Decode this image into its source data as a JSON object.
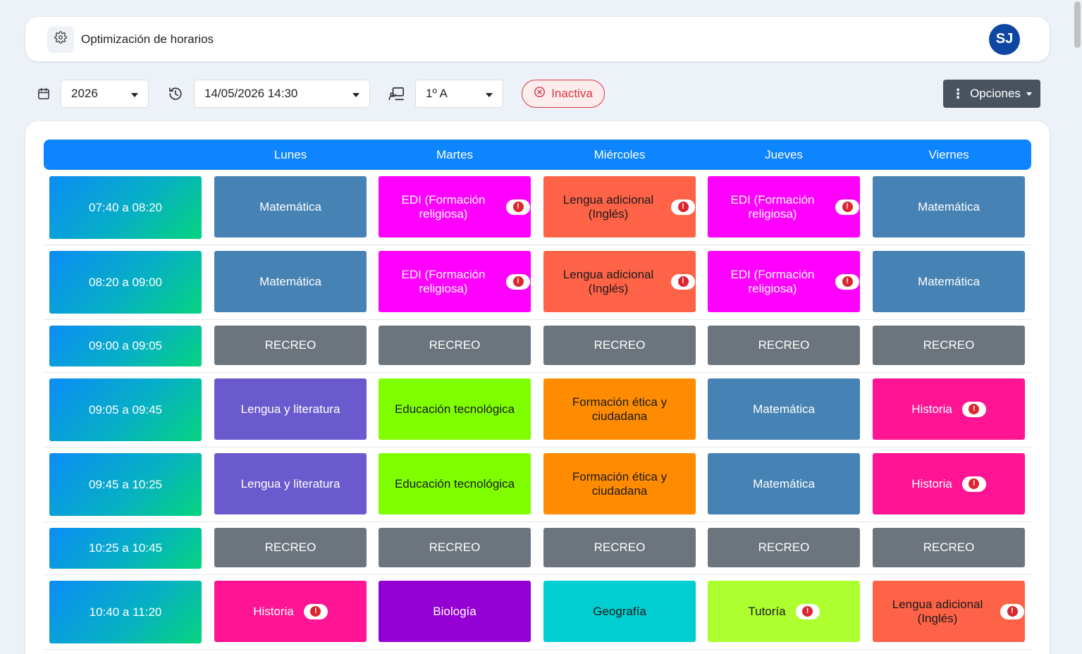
{
  "header": {
    "title": "Optimización de horarios",
    "avatar_initials": "SJ"
  },
  "toolbar": {
    "year_value": "2026",
    "datetime_value": "14/05/2026 14:30",
    "course_value": "1º A",
    "status_label": "Inactiva",
    "options_label": "Opciones"
  },
  "schedule": {
    "days": [
      "Lunes",
      "Martes",
      "Miércoles",
      "Jueves",
      "Viernes"
    ],
    "rows": [
      {
        "time": "07:40 a 08:20",
        "cells": [
          {
            "subject": "Matemática",
            "color": "#4682b4",
            "fg": "#ffffff",
            "alert": false
          },
          {
            "subject": "EDI (Formación religiosa)",
            "color": "#ff00ff",
            "fg": "#ffffff",
            "alert": true
          },
          {
            "subject": "Lengua adicional (Inglés)",
            "color": "#ff6347",
            "fg": "#1a1a1a",
            "alert": true
          },
          {
            "subject": "EDI (Formación religiosa)",
            "color": "#ff00ff",
            "fg": "#ffffff",
            "alert": true
          },
          {
            "subject": "Matemática",
            "color": "#4682b4",
            "fg": "#ffffff",
            "alert": false
          }
        ]
      },
      {
        "time": "08:20 a 09:00",
        "cells": [
          {
            "subject": "Matemática",
            "color": "#4682b4",
            "fg": "#ffffff",
            "alert": false
          },
          {
            "subject": "EDI (Formación religiosa)",
            "color": "#ff00ff",
            "fg": "#ffffff",
            "alert": true
          },
          {
            "subject": "Lengua adicional (Inglés)",
            "color": "#ff6347",
            "fg": "#1a1a1a",
            "alert": true
          },
          {
            "subject": "EDI (Formación religiosa)",
            "color": "#ff00ff",
            "fg": "#ffffff",
            "alert": true
          },
          {
            "subject": "Matemática",
            "color": "#4682b4",
            "fg": "#ffffff",
            "alert": false
          }
        ]
      },
      {
        "time": "09:00 a 09:05",
        "cells": [
          {
            "subject": "RECREO",
            "color": "#6c757d",
            "fg": "#ffffff",
            "alert": false
          },
          {
            "subject": "RECREO",
            "color": "#6c757d",
            "fg": "#ffffff",
            "alert": false
          },
          {
            "subject": "RECREO",
            "color": "#6c757d",
            "fg": "#ffffff",
            "alert": false
          },
          {
            "subject": "RECREO",
            "color": "#6c757d",
            "fg": "#ffffff",
            "alert": false
          },
          {
            "subject": "RECREO",
            "color": "#6c757d",
            "fg": "#ffffff",
            "alert": false
          }
        ]
      },
      {
        "time": "09:05 a 09:45",
        "cells": [
          {
            "subject": "Lengua y literatura",
            "color": "#6a5acd",
            "fg": "#ffffff",
            "alert": false
          },
          {
            "subject": "Educación tecnológica",
            "color": "#7fff00",
            "fg": "#1a1a1a",
            "alert": false
          },
          {
            "subject": "Formación ética y ciudadana",
            "color": "#ff8c00",
            "fg": "#1a1a1a",
            "alert": false
          },
          {
            "subject": "Matemática",
            "color": "#4682b4",
            "fg": "#ffffff",
            "alert": false
          },
          {
            "subject": "Historia",
            "color": "#ff1493",
            "fg": "#ffffff",
            "alert": true
          }
        ]
      },
      {
        "time": "09:45 a 10:25",
        "cells": [
          {
            "subject": "Lengua y literatura",
            "color": "#6a5acd",
            "fg": "#ffffff",
            "alert": false
          },
          {
            "subject": "Educación tecnológica",
            "color": "#7fff00",
            "fg": "#1a1a1a",
            "alert": false
          },
          {
            "subject": "Formación ética y ciudadana",
            "color": "#ff8c00",
            "fg": "#1a1a1a",
            "alert": false
          },
          {
            "subject": "Matemática",
            "color": "#4682b4",
            "fg": "#ffffff",
            "alert": false
          },
          {
            "subject": "Historia",
            "color": "#ff1493",
            "fg": "#ffffff",
            "alert": true
          }
        ]
      },
      {
        "time": "10:25 a 10:45",
        "cells": [
          {
            "subject": "RECREO",
            "color": "#6c757d",
            "fg": "#ffffff",
            "alert": false
          },
          {
            "subject": "RECREO",
            "color": "#6c757d",
            "fg": "#ffffff",
            "alert": false
          },
          {
            "subject": "RECREO",
            "color": "#6c757d",
            "fg": "#ffffff",
            "alert": false
          },
          {
            "subject": "RECREO",
            "color": "#6c757d",
            "fg": "#ffffff",
            "alert": false
          },
          {
            "subject": "RECREO",
            "color": "#6c757d",
            "fg": "#ffffff",
            "alert": false
          }
        ]
      },
      {
        "time": "10:40 a 11:20",
        "cells": [
          {
            "subject": "Historia",
            "color": "#ff1493",
            "fg": "#ffffff",
            "alert": true
          },
          {
            "subject": "Biología",
            "color": "#9400d3",
            "fg": "#ffffff",
            "alert": false
          },
          {
            "subject": "Geografía",
            "color": "#00ced1",
            "fg": "#1a1a1a",
            "alert": false
          },
          {
            "subject": "Tutoría",
            "color": "#adff2f",
            "fg": "#1a1a1a",
            "alert": true
          },
          {
            "subject": "Lengua adicional (Inglés)",
            "color": "#ff6347",
            "fg": "#1a1a1a",
            "alert": true
          }
        ]
      }
    ]
  }
}
